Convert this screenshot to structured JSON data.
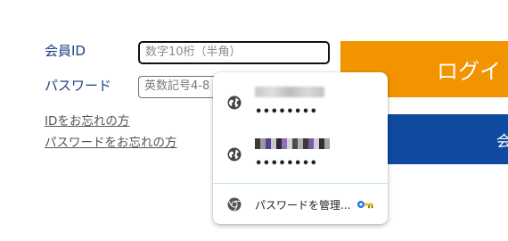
{
  "form": {
    "member_id_label": "会員ID",
    "password_label": "パスワード",
    "member_id_placeholder": "数字10桁（半角）",
    "password_placeholder": "英数記号4-8"
  },
  "links": {
    "forgot_id": "IDをお忘れの方",
    "forgot_password": "パスワードをお忘れの方"
  },
  "buttons": {
    "login": "ログイ",
    "register": "会"
  },
  "autofill": {
    "entries": [
      {
        "password_mask": "••••••••",
        "icon": "globe-icon"
      },
      {
        "password_mask": "••••••••",
        "icon": "globe-icon"
      }
    ],
    "manage_label": "パスワードを管理...",
    "manage_icon": "chrome-icon",
    "key_icon": "key-icon"
  },
  "colors": {
    "label": "#1f3f86",
    "login_button": "#f29400",
    "register_button": "#0d4aa0"
  }
}
